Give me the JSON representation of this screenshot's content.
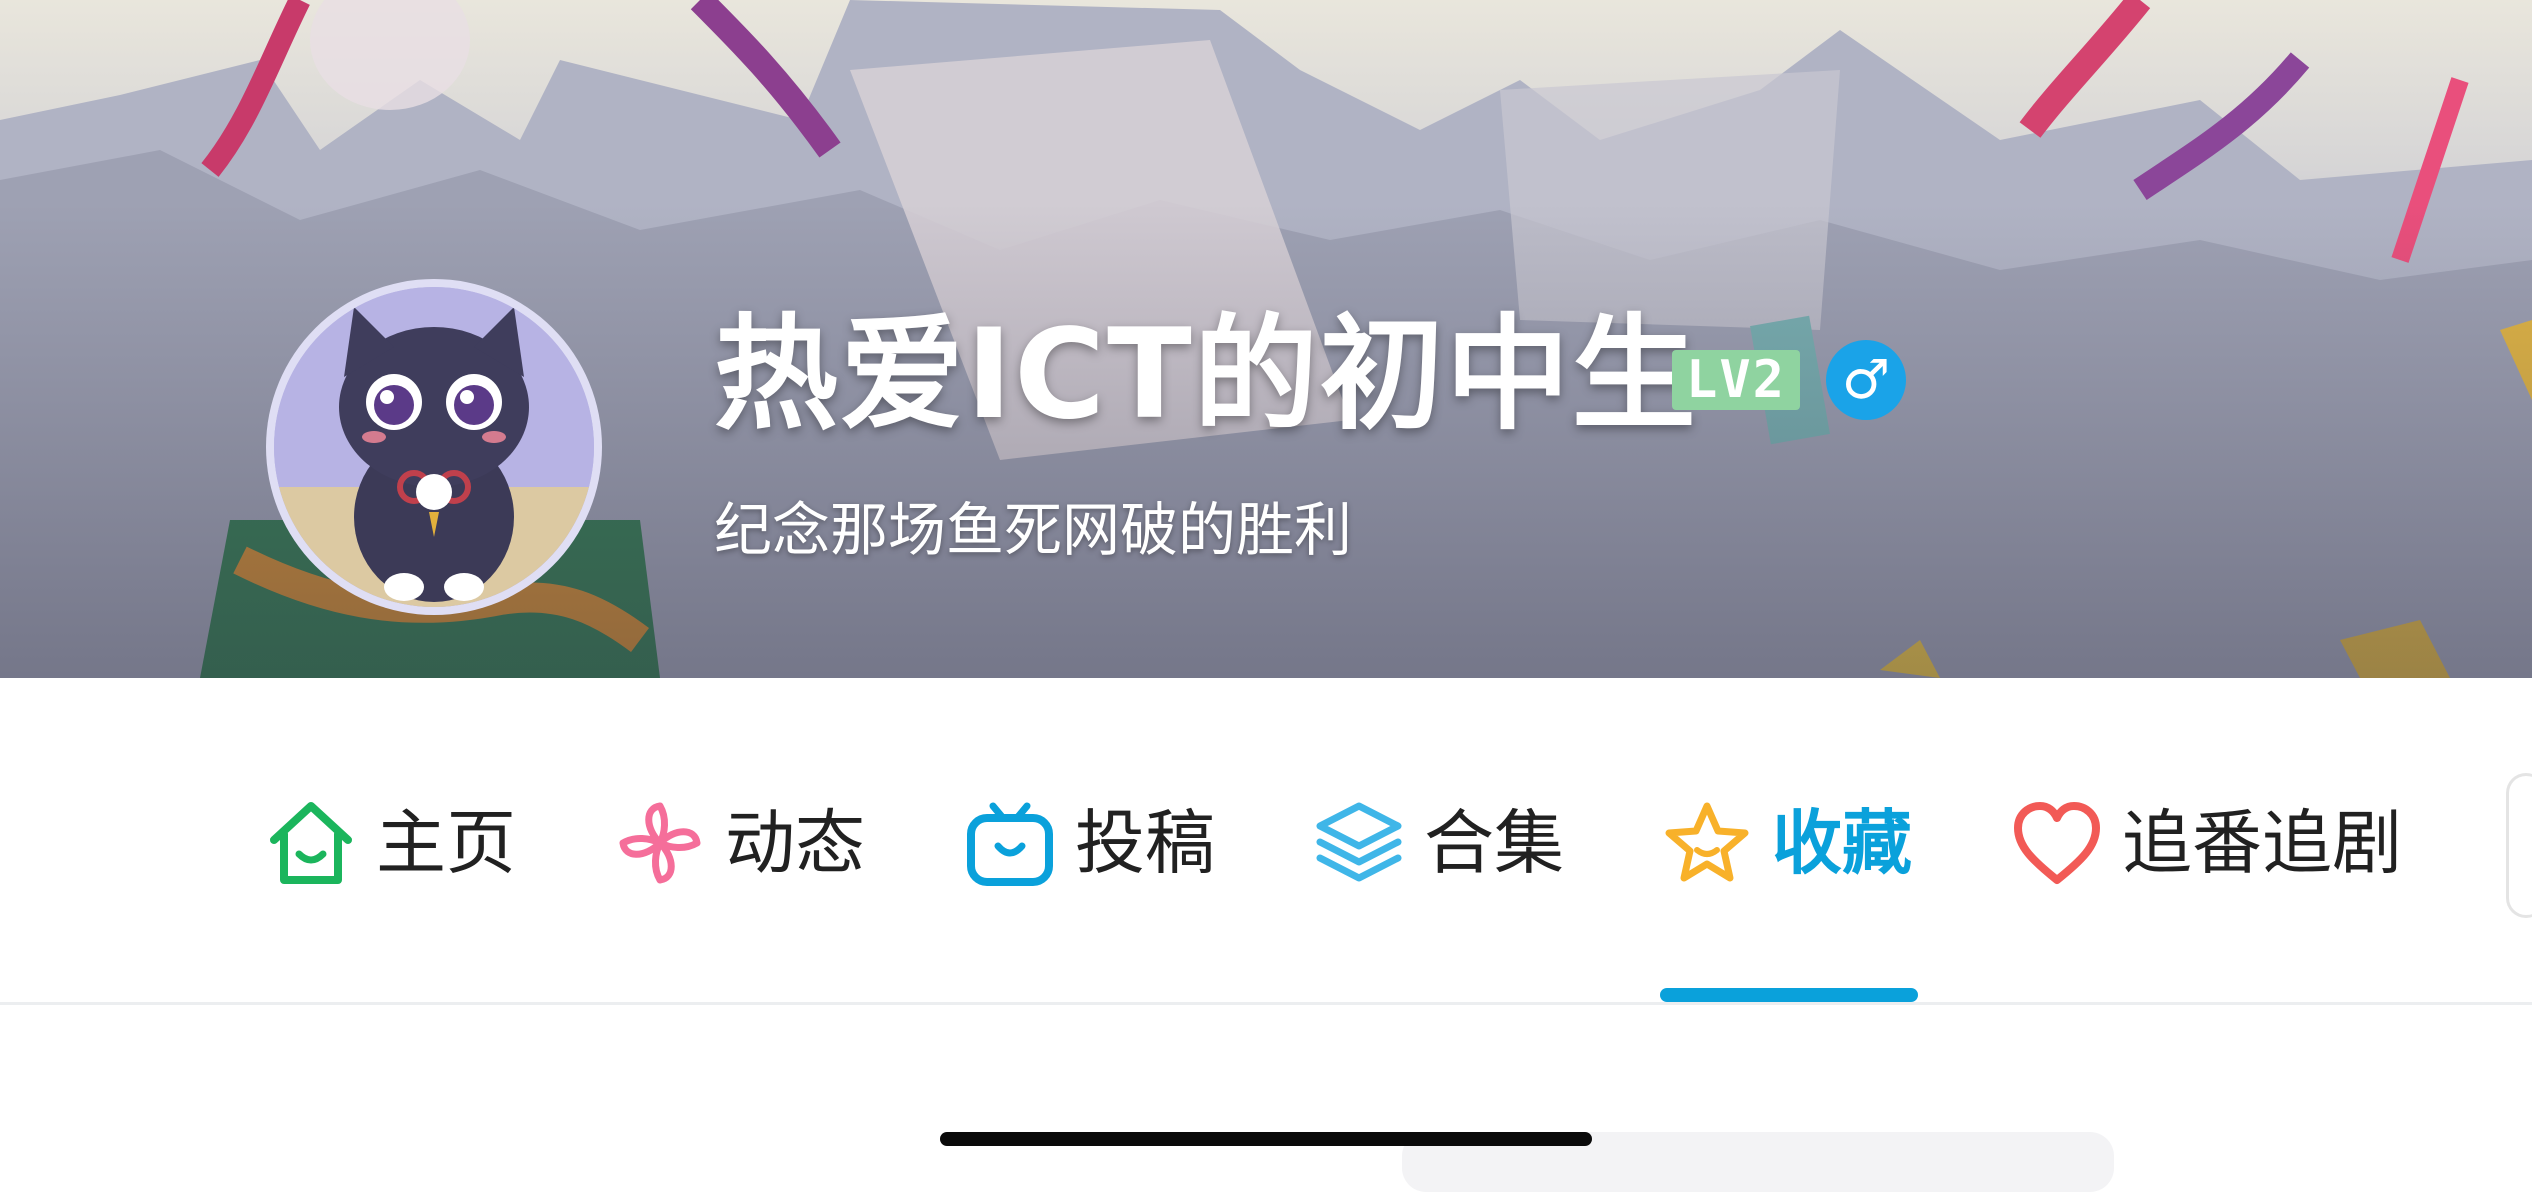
{
  "profile": {
    "username": "热爱ICT的初中生",
    "level": "LV2",
    "gender_symbol": "♂",
    "signature": "纪念那场鱼死网破的胜利"
  },
  "tabs": [
    {
      "label": "主页",
      "icon": "home-icon",
      "color": "#1bb55c"
    },
    {
      "label": "动态",
      "icon": "pinwheel-icon",
      "color": "#f56e9a"
    },
    {
      "label": "投稿",
      "icon": "tv-icon",
      "color": "#0aa1db"
    },
    {
      "label": "合集",
      "icon": "layers-icon",
      "color": "#3fb6e8"
    },
    {
      "label": "收藏",
      "icon": "star-icon",
      "color": "#f8b12a",
      "active": true
    },
    {
      "label": "追番追剧",
      "icon": "heart-icon",
      "color": "#f25a56"
    }
  ],
  "colors": {
    "accent": "#0aa1db",
    "level_badge": "#8fd3a0",
    "gender_badge": "#1aa3e8"
  }
}
